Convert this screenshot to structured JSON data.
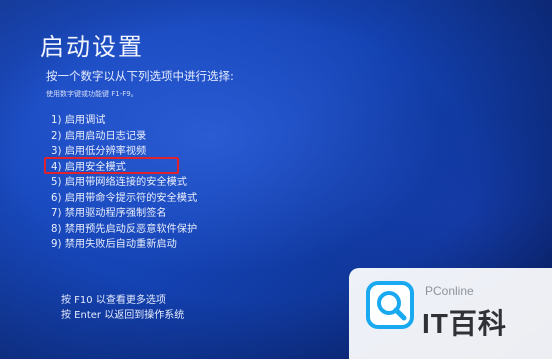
{
  "screen": {
    "title": "启动设置",
    "prompt": "按一个数字以从下列选项中进行选择:",
    "hint": "使用数字键或功能键 F1-F9。",
    "options": [
      "1) 启用调试",
      "2) 启用启动日志记录",
      "3) 启用低分辨率视频",
      "4) 启用安全模式",
      "5) 启用带网络连接的安全模式",
      "6) 启用带命令提示符的安全模式",
      "7) 禁用驱动程序强制签名",
      "8) 禁用预先启动反恶意软件保护",
      "9) 禁用失败后自动重新启动"
    ],
    "highlighted_option": "4) 启用安全模式",
    "footer": {
      "more_options": "按 F10 以查看更多选项",
      "return": "按 Enter 以返回到操作系统"
    }
  },
  "watermark": {
    "brand": "PConline",
    "name": "IT百科"
  },
  "colors": {
    "background": "#1443b4",
    "text": "#e9eefc",
    "highlight": "#e0222f",
    "logo_accent": "#19a9f0"
  },
  "icons": {
    "logo": "magnifier-logo-icon"
  }
}
